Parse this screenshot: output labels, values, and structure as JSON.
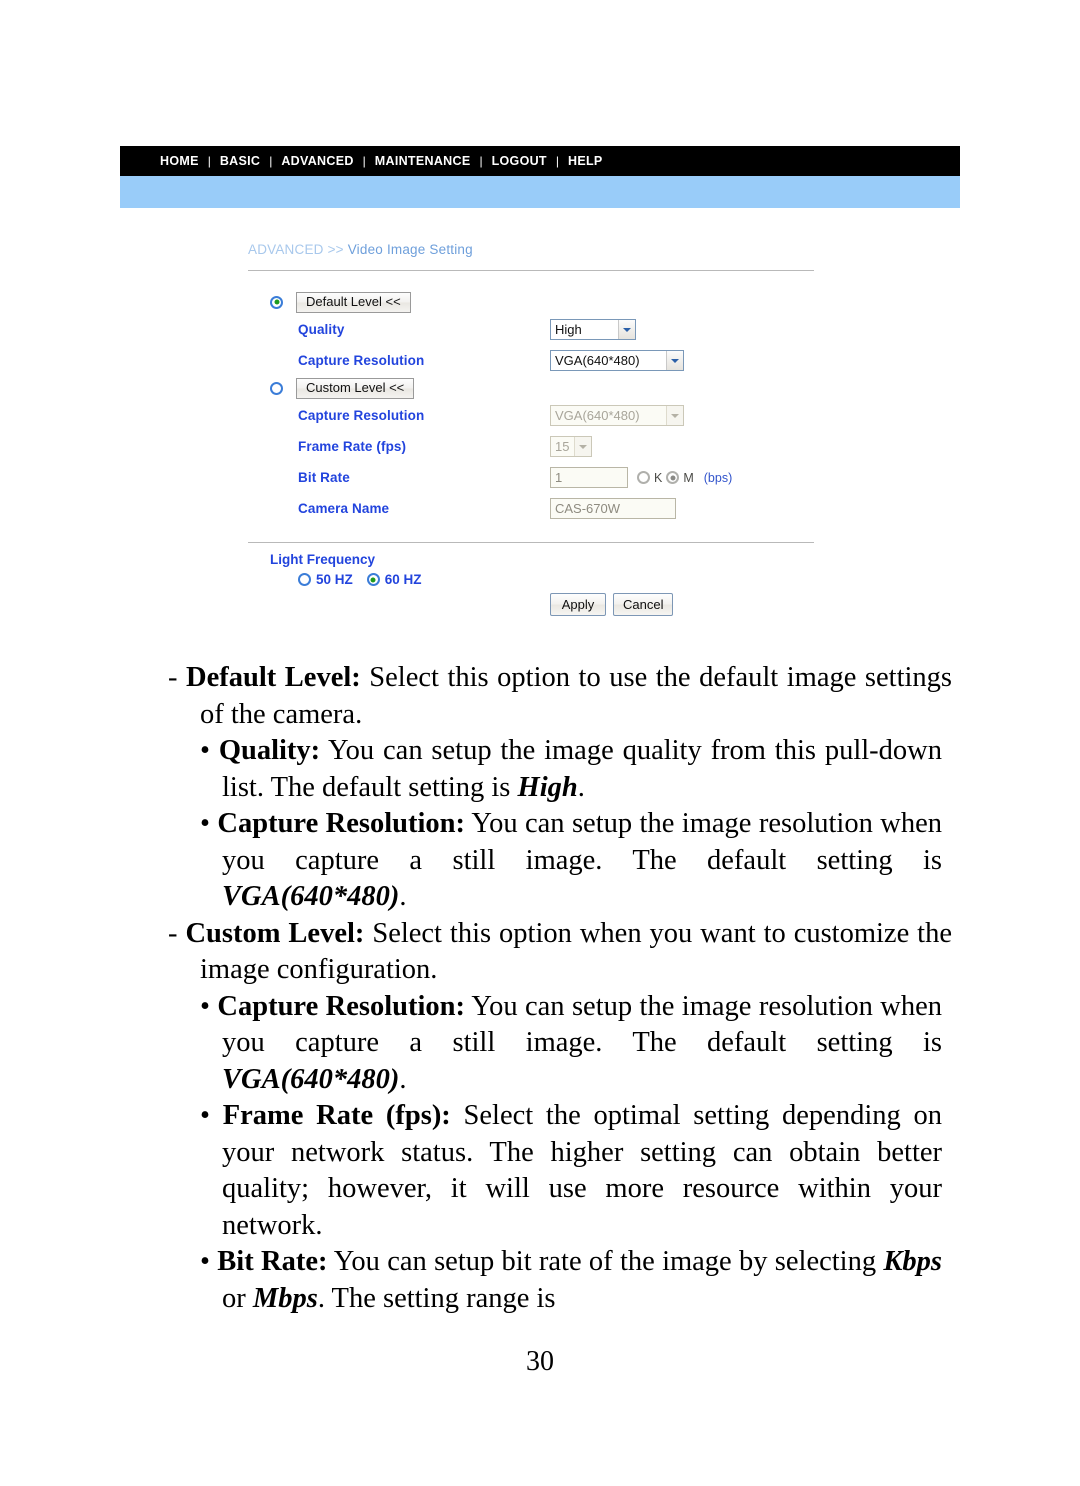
{
  "screenshot_panel": {
    "nav": {
      "items": [
        "HOME",
        "BASIC",
        "ADVANCED",
        "MAINTENANCE",
        "LOGOUT",
        "HELP"
      ],
      "separator": "|"
    },
    "breadcrumb": {
      "root": "ADVANCED",
      "separator": ">>",
      "leaf": "Video Image Setting"
    },
    "default_level": {
      "button_label": "Default Level <<",
      "radio_selected": true,
      "quality": {
        "label": "Quality",
        "value": "High"
      },
      "capture_resolution": {
        "label": "Capture Resolution",
        "value": "VGA(640*480)"
      }
    },
    "custom_level": {
      "button_label": "Custom Level <<",
      "radio_selected": false,
      "capture_resolution": {
        "label": "Capture Resolution",
        "value": "VGA(640*480)"
      },
      "frame_rate": {
        "label": "Frame Rate (fps)",
        "value": "15"
      },
      "bit_rate": {
        "label": "Bit Rate",
        "value": "1",
        "unit_k": "K",
        "unit_m": "M",
        "unit_suffix": "(bps)",
        "selected_unit": "M"
      },
      "camera_name": {
        "label": "Camera Name",
        "value": "CAS-670W"
      }
    },
    "light_frequency": {
      "label": "Light Frequency",
      "option_50": "50 HZ",
      "option_60": "60 HZ",
      "selected": "60 HZ"
    },
    "actions": {
      "apply_label": "Apply",
      "cancel_label": "Cancel"
    },
    "colors": {
      "nav_background": "#000000",
      "banner": "#99ccf9",
      "label_blue": "#2244dd",
      "breadcrumb_blue": "#7aa8e0",
      "radio_ring": "#3b7dd8",
      "radio_dot": "#1f9b1f"
    }
  },
  "document": {
    "paragraphs": [
      {
        "level": 1,
        "marker": "-",
        "term": "Default Level:",
        "body": " Select this option to use the default image settings of the camera."
      },
      {
        "level": 2,
        "marker": "•",
        "term": "Quality:",
        "body_before": " You can setup the image quality from this pull-down list.  The default setting is ",
        "emphasis": "High",
        "body_after": "."
      },
      {
        "level": 2,
        "marker": "•",
        "term": "Capture Resolution:",
        "body_before": " You can setup the image resolution when you capture a still image.  The default setting is ",
        "emphasis": "VGA(640*480)",
        "body_after": "."
      },
      {
        "level": 1,
        "marker": "-",
        "term": "Custom Level:",
        "body": " Select this option when you want to customize the image configuration."
      },
      {
        "level": 2,
        "marker": "•",
        "term": "Capture Resolution:",
        "body_before": " You can setup the image resolution when you capture a still image.  The default setting is ",
        "emphasis": "VGA(640*480)",
        "body_after": "."
      },
      {
        "level": 2,
        "marker": "•",
        "term": "Frame Rate (fps):",
        "body": " Select the optimal setting depending on your network status.  The higher setting can obtain better quality; however, it will use more resource within your network."
      },
      {
        "level": 2,
        "marker": "•",
        "term": "Bit Rate:",
        "body_before": " You can setup bit rate of the image by selecting ",
        "emphasis": "Kbps",
        "body_mid": " or ",
        "emphasis2": "Mbps",
        "body_after": ".   The setting range is"
      }
    ],
    "page_number": "30"
  }
}
